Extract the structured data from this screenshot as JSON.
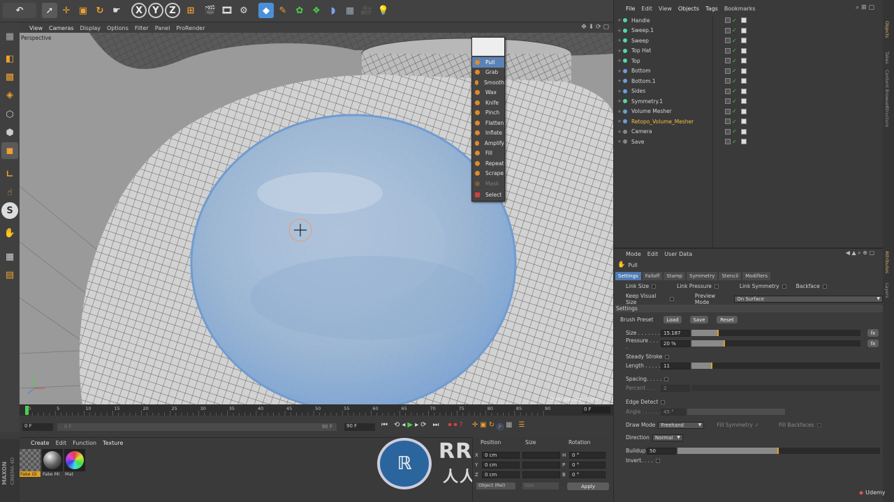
{
  "toolbar": {
    "axis_x": "X",
    "axis_y": "Y",
    "axis_z": "Z"
  },
  "viewport": {
    "menu": [
      "View",
      "Cameras",
      "Display",
      "Options",
      "Filter",
      "Panel",
      "ProRender"
    ],
    "projection_label": "Perspective",
    "grid_spacing": "Grid Spacing : 1 cm"
  },
  "brush_menu": {
    "items": [
      "Pull",
      "Grab",
      "Smooth",
      "Wax",
      "Knife",
      "Pinch",
      "Flatten",
      "Inflate",
      "Amplify",
      "Fill",
      "Repeat",
      "Scrape",
      "Mask",
      "Select"
    ],
    "selected": "Pull"
  },
  "object_manager": {
    "menu": [
      "File",
      "Edit",
      "View",
      "Objects",
      "Tags",
      "Bookmarks"
    ],
    "objects": [
      {
        "name": "Handle",
        "color": "#54d8a8"
      },
      {
        "name": "Sweep.1",
        "color": "#54d8a8"
      },
      {
        "name": "Sweep",
        "color": "#54d8a8"
      },
      {
        "name": "Top Hat",
        "color": "#54d8a8"
      },
      {
        "name": "Top",
        "color": "#54d8a8"
      },
      {
        "name": "Bottom",
        "color": "#6aa0e0"
      },
      {
        "name": "Bottom.1",
        "color": "#6aa0e0"
      },
      {
        "name": "Sides",
        "color": "#6aa0e0"
      },
      {
        "name": "Symmetry.1",
        "color": "#54d8a8"
      },
      {
        "name": "Volume Mesher",
        "color": "#6aa0e0"
      },
      {
        "name": "Retopo_Volume_Mesher",
        "color": "#6aa0e0"
      },
      {
        "name": "Camera",
        "color": "#888888"
      },
      {
        "name": "Save",
        "color": "#888888"
      }
    ],
    "highlighted": "Retopo_Volume_Mesher"
  },
  "side_tabs": [
    "Objects",
    "Takes",
    "Content Browser",
    "Structure"
  ],
  "attributes": {
    "menu": [
      "Mode",
      "Edit",
      "User Data"
    ],
    "tool_name": "Pull",
    "tabs": [
      "Settings",
      "Falloff",
      "Stamp",
      "Symmetry",
      "Stencil",
      "Modifiers"
    ],
    "link_size": "Link Size",
    "link_pressure": "Link Pressure",
    "link_symmetry": "Link Symmetry",
    "backface": "Backface",
    "keep_visual_size": "Keep Visual Size",
    "preview_mode_label": "Preview Mode",
    "preview_mode_value": "On Surface",
    "section_settings": "Settings",
    "brush_preset": "Brush Preset",
    "load": "Load",
    "save": "Save",
    "reset": "Reset",
    "size_label": "Size . . . . . . .",
    "size_value": "15.187",
    "pressure_label": "Pressure . . . .",
    "pressure_value": "20 %",
    "steady_stroke": "Steady Stroke",
    "length_label": "Length . . . . .",
    "length_value": "11",
    "spacing": "Spacing. . . . .",
    "percent_label": "Percent . . .",
    "percent_value": "2",
    "edge_detect": "Edge Detect",
    "angle_label": "Angle . . . . . .",
    "angle_value": "45 °",
    "draw_mode_label": "Draw Mode",
    "draw_mode_value": "Freehand",
    "fill_symmetry": "Fill Symmetry",
    "fill_backfaces": "Fill Backfaces",
    "direction_label": "Direction",
    "direction_value": "Normal",
    "buildup_label": "Buildup",
    "buildup_value": "50",
    "invert": "Invert. . . .",
    "size_fraction": 0.16,
    "pressure_fraction": 0.2,
    "length_fraction": 0.11,
    "buildup_fraction": 0.5,
    "side_tabs": [
      "Attributes",
      "Layers"
    ]
  },
  "timeline": {
    "ticks": [
      "0",
      "5",
      "10",
      "15",
      "20",
      "25",
      "30",
      "35",
      "40",
      "45",
      "50",
      "55",
      "60",
      "65",
      "70",
      "75",
      "80",
      "85",
      "90"
    ],
    "current_frame": "0 F",
    "start": "0 F",
    "min": "0 F",
    "max": "90 F",
    "end": "90 F"
  },
  "material_manager": {
    "menu": [
      "Create",
      "Edit",
      "Function",
      "Texture"
    ],
    "materials": [
      "Fake Gl",
      "Fake Mi",
      "Mat"
    ]
  },
  "coordinates": {
    "headers": [
      "Position",
      "Size",
      "Rotation"
    ],
    "rows": [
      {
        "axis": "X",
        "pos": "0 cm",
        "size_axis": "H",
        "rot": "0 °"
      },
      {
        "axis": "Y",
        "pos": "0 cm",
        "size_axis": "P",
        "rot": "0 °"
      },
      {
        "axis": "Z",
        "pos": "0 cm",
        "size_axis": "B",
        "rot": "0 °"
      }
    ],
    "mode": "Object (Rel)",
    "size_mode": "Size",
    "apply": "Apply"
  },
  "brand": {
    "maxon": "MAXON",
    "cinema": "CINEMA 4D",
    "watermark_top": "RRCG",
    "watermark_bottom": "人人素材",
    "udemy": "Udemy"
  }
}
